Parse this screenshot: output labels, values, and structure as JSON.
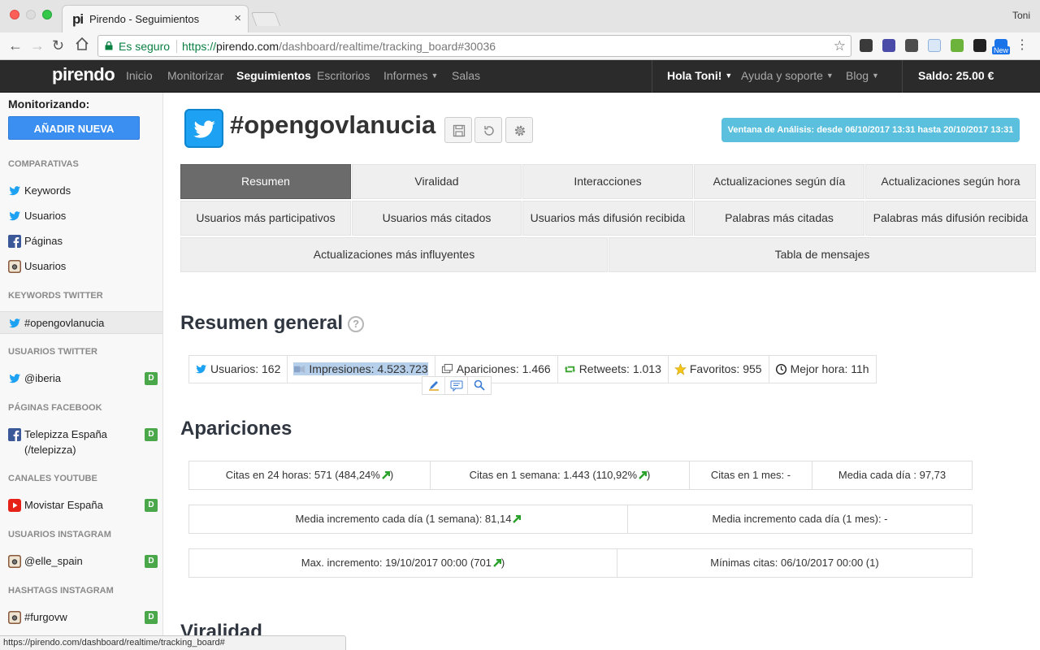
{
  "browser": {
    "tab_title": "Pirendo - Seguimientos",
    "tab_favicon_text": "pi",
    "tab_close": "×",
    "os_user": "Toni",
    "secure_label": "Es seguro",
    "url_protocol": "https://",
    "url_domain": "pirendo.com",
    "url_path": "/dashboard/realtime/tracking_board#30036",
    "new_badge": "New",
    "status_url": "https://pirendo.com/dashboard/realtime/tracking_board#"
  },
  "navbar": {
    "logo": "pirendo",
    "items": [
      "Inicio",
      "Monitorizar",
      "Seguimientos",
      "Escritorios",
      "Informes",
      "Salas"
    ],
    "active": "Seguimientos",
    "greeting": "Hola Toni!",
    "help": "Ayuda y soporte",
    "blog": "Blog",
    "balance": "Saldo: 25.00 €"
  },
  "sidebar": {
    "monitoring_label": "Monitorizando:",
    "add_button": "AÑADIR NUEVA",
    "sections": {
      "comparativas": "COMPARATIVAS",
      "keywords_twitter": "KEYWORDS TWITTER",
      "usuarios_twitter": "USUARIOS TWITTER",
      "paginas_facebook": "PÁGINAS FACEBOOK",
      "canales_youtube": "CANALES YOUTUBE",
      "usuarios_instagram": "USUARIOS INSTAGRAM",
      "hashtags_instagram": "HASHTAGS INSTAGRAM"
    },
    "comparativas": [
      "Keywords",
      "Usuarios",
      "Páginas",
      "Usuarios"
    ],
    "keyword": "#opengovlanucia",
    "twitter_user": "@iberia",
    "facebook_page_line1": "Telepizza España",
    "facebook_page_line2": "(/telepizza)",
    "youtube_channel": "Movistar España",
    "instagram_user": "@elle_spain",
    "instagram_hashtag": "#furgovw",
    "badge": "D"
  },
  "main": {
    "title": "#opengovlanucia",
    "analysis_window": "Ventana de Análisis: desde 06/10/2017 13:31 hasta 20/10/2017 13:31",
    "tabs_row1": [
      "Resumen",
      "Viralidad",
      "Interacciones",
      "Actualizaciones según día",
      "Actualizaciones según hora"
    ],
    "tabs_row2": [
      "Usuarios más participativos",
      "Usuarios más citados",
      "Usuarios más difusión recibida",
      "Palabras más citadas",
      "Palabras más difusión recibida"
    ],
    "tabs_row3": [
      "Actualizaciones más influyentes",
      "Tabla de mensajes"
    ],
    "active_tab": "Resumen",
    "summary_title": "Resumen general",
    "help_mark": "?",
    "stats": {
      "usuarios": "Usuarios: 162",
      "impresiones": "Impresiones: 4.523.723",
      "apariciones": "Apariciones: 1.466",
      "retweets": "Retweets: 1.013",
      "favoritos": "Favoritos: 955",
      "mejor_hora": "Mejor hora: 11h"
    },
    "apariciones_title": "Apariciones",
    "row1": {
      "c24_pre": "Citas en 24 horas: 571 (484,24%",
      "c24_post": ")",
      "c1s_pre": "Citas en 1 semana: 1.443 (110,92%",
      "c1s_post": ")",
      "c1m": "Citas en 1 mes: -",
      "media": "Media cada día : 97,73"
    },
    "row2": {
      "semana": "Media incremento cada día (1 semana): 81,14",
      "mes": "Media incremento cada día (1 mes): -"
    },
    "row3": {
      "max_pre": "Max. incremento: 19/10/2017 00:00 (701",
      "max_post": ")",
      "min": "Mínimas citas: 06/10/2017 00:00 (1)"
    },
    "viralidad_title": "Viralidad"
  },
  "colors": {
    "accent_blue": "#3b8ff0",
    "twitter_blue": "#1da1f2",
    "info_badge": "#5bc0de",
    "badge_green": "#4aa84a",
    "navbar_bg": "#2b2b2b"
  }
}
